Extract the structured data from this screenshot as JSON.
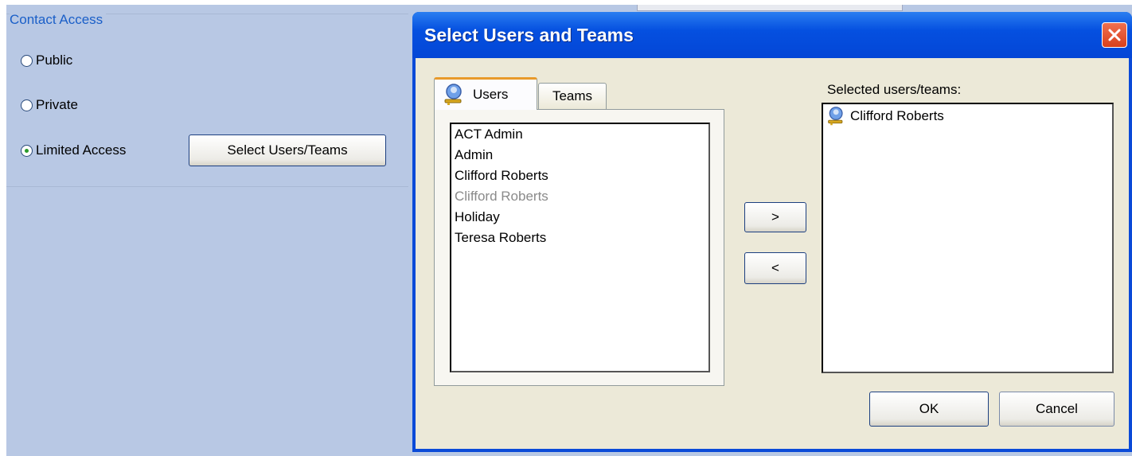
{
  "contact_access": {
    "title": "Contact Access",
    "options": [
      {
        "label": "Public",
        "checked": false
      },
      {
        "label": "Private",
        "checked": false
      },
      {
        "label": "Limited Access",
        "checked": true
      }
    ],
    "select_button": "Select Users/Teams"
  },
  "dialog": {
    "title": "Select Users and Teams",
    "tabs": [
      {
        "label": "Users",
        "active": true,
        "icon": "user-key-icon"
      },
      {
        "label": "Teams",
        "active": false
      }
    ],
    "users": [
      {
        "name": "ACT Admin",
        "enabled": true
      },
      {
        "name": "Admin",
        "enabled": true
      },
      {
        "name": "Clifford Roberts",
        "enabled": true
      },
      {
        "name": "Clifford Roberts",
        "enabled": false
      },
      {
        "name": "Holiday",
        "enabled": true
      },
      {
        "name": "Teresa Roberts",
        "enabled": true
      }
    ],
    "add_button": ">",
    "remove_button": "<",
    "selected_label": "Selected users/teams:",
    "selected": [
      {
        "name": "Clifford Roberts",
        "icon": "user-key-icon"
      }
    ],
    "ok_button": "OK",
    "cancel_button": "Cancel"
  },
  "colors": {
    "titlebar": "#0550e0",
    "background_panel": "#b8c8e4",
    "dialog_body": "#ece9d8",
    "group_title": "#1a5fc8",
    "close_button": "#d8401c"
  }
}
